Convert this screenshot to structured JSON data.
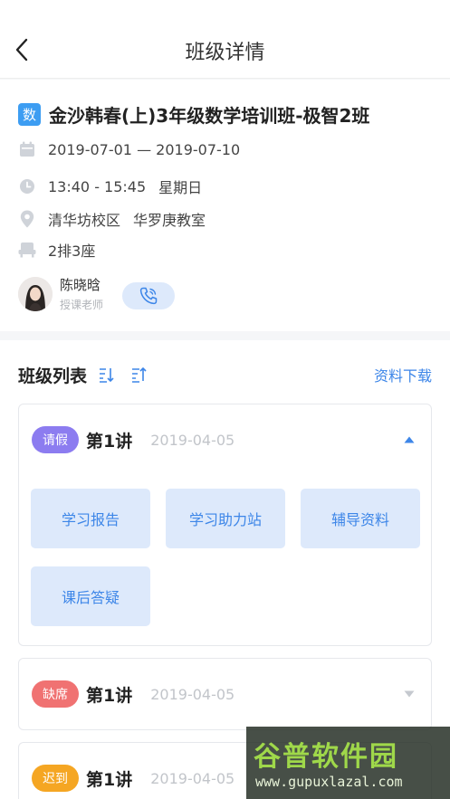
{
  "header": {
    "title": "班级详情"
  },
  "course": {
    "subject_badge": "数",
    "title": "金沙韩春(上)3年级数学培训班-极智2班",
    "date_range": "2019-07-01 — 2019-07-10",
    "time": "13:40 - 15:45",
    "weekday": "星期日",
    "campus": "清华坊校区",
    "classroom": "华罗庚教室",
    "seat": "2排3座"
  },
  "teacher": {
    "name": "陈晓晗",
    "role": "授课老师"
  },
  "class_list": {
    "title": "班级列表",
    "download_label": "资料下载",
    "cards": [
      {
        "tag": "请假",
        "tag_color": "#8c7cf0",
        "lecture": "第1讲",
        "date": "2019-04-05",
        "expanded": true,
        "actions": [
          "学习报告",
          "学习助力站",
          "辅导资料",
          "课后答疑"
        ]
      },
      {
        "tag": "缺席",
        "tag_color": "#f07272",
        "lecture": "第1讲",
        "date": "2019-04-05",
        "expanded": false
      },
      {
        "tag": "迟到",
        "tag_color": "#f5a623",
        "lecture": "第1讲",
        "date": "2019-04-05",
        "expanded": false
      }
    ]
  },
  "watermark": {
    "text": "谷普软件园",
    "url": "www.gupuxlazal.com"
  },
  "colors": {
    "accent": "#3d86e8",
    "button_bg": "#dde9fb",
    "badge": "#3d9df2"
  }
}
